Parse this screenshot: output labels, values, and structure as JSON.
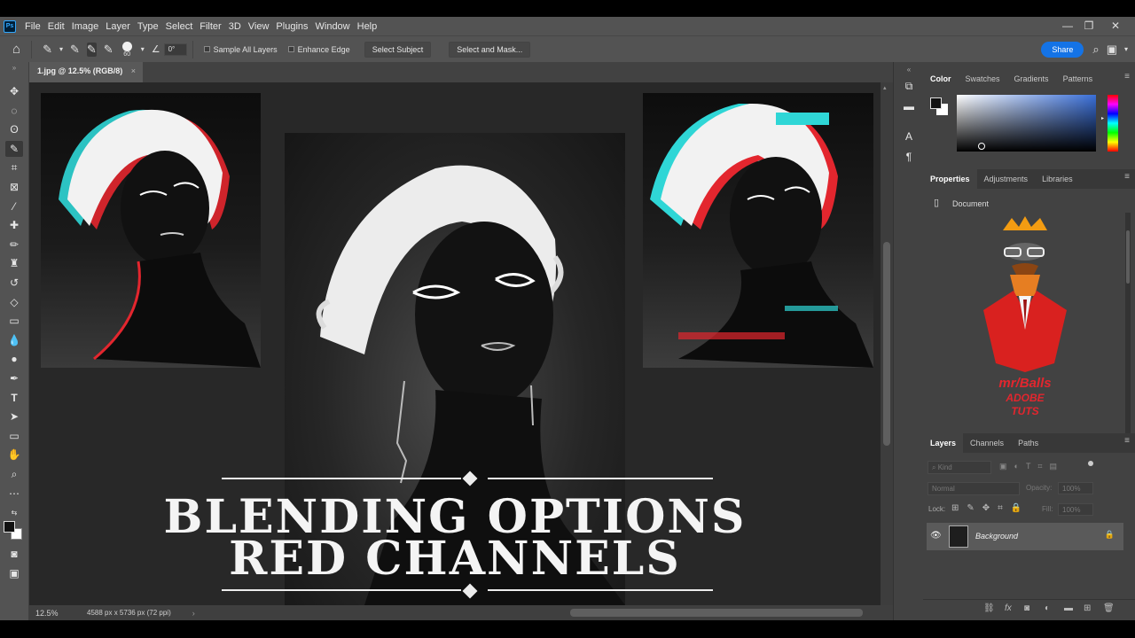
{
  "app": {
    "logo_text": "Ps",
    "menu": [
      "File",
      "Edit",
      "Image",
      "Layer",
      "Type",
      "Select",
      "Filter",
      "3D",
      "View",
      "Plugins",
      "Window",
      "Help"
    ],
    "window_controls": [
      "—",
      "❐",
      "✕"
    ]
  },
  "options_bar": {
    "brush_size": "60",
    "angle": "0°",
    "sample_all_layers": "Sample All Layers",
    "enhance_edge": "Enhance Edge",
    "select_subject": "Select Subject",
    "select_and_mask": "Select and Mask...",
    "share": "Share"
  },
  "document": {
    "tab_title": "1.jpg @ 12.5% (RGB/8)",
    "tab_close": "×",
    "zoom": "12.5%",
    "doc_info": "4588 px x 5736 px (72 ppi)"
  },
  "canvas": {
    "title_line1": "BLENDING OPTIONS",
    "title_line2": "RED CHANNELS"
  },
  "color_panel": {
    "tabs": [
      "Color",
      "Swatches",
      "Gradients",
      "Patterns"
    ],
    "active_tab": "Color"
  },
  "properties_panel": {
    "tabs": [
      "Properties",
      "Adjustments",
      "Libraries"
    ],
    "active_tab": "Properties",
    "document_label": "Document",
    "logo_text": "mr/Balls ADOBE TUTS"
  },
  "layers_panel": {
    "tabs": [
      "Layers",
      "Channels",
      "Paths"
    ],
    "active_tab": "Layers",
    "kind_placeholder": "Kind",
    "blend_mode": "Normal",
    "opacity_label": "Opacity:",
    "opacity_value": "100%",
    "lock_label": "Lock:",
    "fill_label": "Fill:",
    "fill_value": "100%",
    "layer_name": "Background"
  },
  "colors": {
    "ui_dark": "#535353",
    "panel": "#424242",
    "canvas_bg": "#282828",
    "accent_blue": "#1473e6",
    "glitch_red": "#e3262e",
    "glitch_cyan": "#2fd6d6"
  }
}
